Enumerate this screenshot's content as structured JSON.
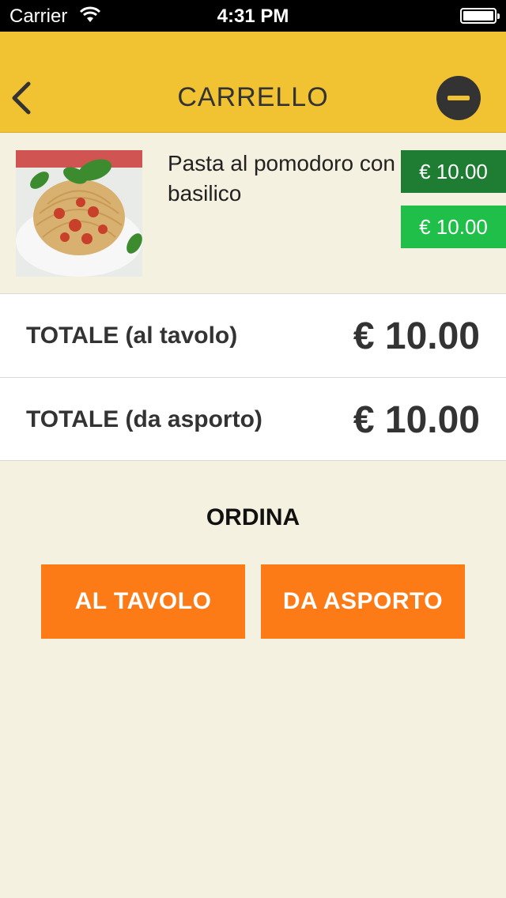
{
  "status_bar": {
    "carrier": "Carrier",
    "time": "4:31 PM"
  },
  "navbar": {
    "title": "CARRELLO",
    "back_icon": "chevron-left-icon",
    "remove_icon": "minus-circle-icon"
  },
  "cart": {
    "items": [
      {
        "name": "Pasta al pomodoro con basilico",
        "price_table": "€ 10.00",
        "price_takeaway": "€ 10.00",
        "image": "spaghetti-photo"
      }
    ]
  },
  "totals": {
    "table_label": "TOTALE (al tavolo)",
    "table_amount": "€ 10.00",
    "takeaway_label": "TOTALE (da asporto)",
    "takeaway_amount": "€ 10.00"
  },
  "order": {
    "heading": "ORDINA",
    "table_button": "AL TAVOLO",
    "takeaway_button": "DA ASPORTO"
  },
  "colors": {
    "navbar_bg": "#f1c232",
    "page_bg": "#f5f1e0",
    "price_table_bg": "#1e7d32",
    "price_takeaway_bg": "#1fbf4a",
    "order_button_bg": "#fd7b16"
  }
}
